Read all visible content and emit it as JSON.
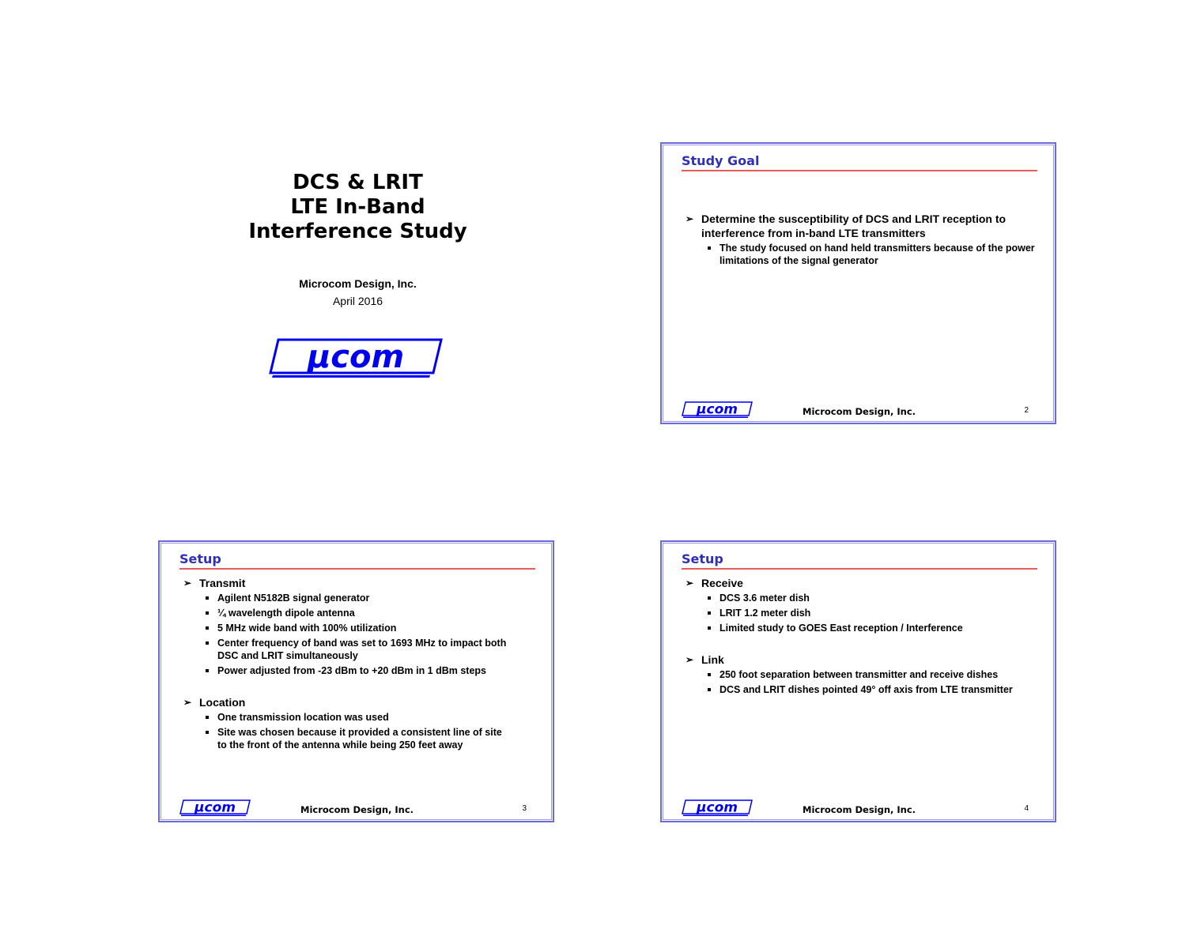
{
  "title_slide": {
    "title_lines": [
      "DCS & LRIT",
      "LTE In-Band",
      "Interference Study"
    ],
    "company": "Microcom Design, Inc.",
    "date": "April 2016",
    "logo_text": "µcom"
  },
  "footer": {
    "company": "Microcom Design, Inc.",
    "logo_text": "µcom"
  },
  "slides": [
    {
      "title": "Study Goal",
      "page": "2",
      "groups": [
        {
          "heading": "Determine the susceptibility of DCS and LRIT reception to interference from in-band LTE transmitters",
          "items": [
            "The study focused on hand held transmitters because of the power limitations of the signal generator"
          ]
        }
      ]
    },
    {
      "title": "Setup",
      "page": "3",
      "groups": [
        {
          "heading": "Transmit",
          "items": [
            "Agilent N5182B signal generator",
            "¼ wavelength dipole antenna",
            "5 MHz wide band with 100% utilization",
            "Center frequency of band was set to 1693 MHz to impact both DSC and LRIT simultaneously",
            "Power adjusted from -23 dBm to +20 dBm in 1 dBm steps"
          ]
        },
        {
          "heading": "Location",
          "items": [
            "One transmission location was used",
            "Site was chosen because it provided a consistent line of site to the front of the antenna while being 250 feet away"
          ]
        }
      ]
    },
    {
      "title": "Setup",
      "page": "4",
      "groups": [
        {
          "heading": "Receive",
          "items": [
            "DCS 3.6 meter dish",
            "LRIT 1.2 meter dish",
            "Limited study to GOES East reception / Interference"
          ]
        },
        {
          "heading": "Link",
          "items": [
            "250 foot separation between transmitter and receive dishes",
            "DCS and LRIT dishes pointed 49° off axis from LTE transmitter"
          ]
        }
      ]
    }
  ],
  "colors": {
    "slide_title": "#2f2fb8",
    "rule": "#e85a5a",
    "frame": "#6b6bd8",
    "logo": "#0000ee"
  },
  "icons": {
    "bullet_l1": "arrowhead-bullet-icon",
    "bullet_l2": "square-bullet-icon"
  }
}
